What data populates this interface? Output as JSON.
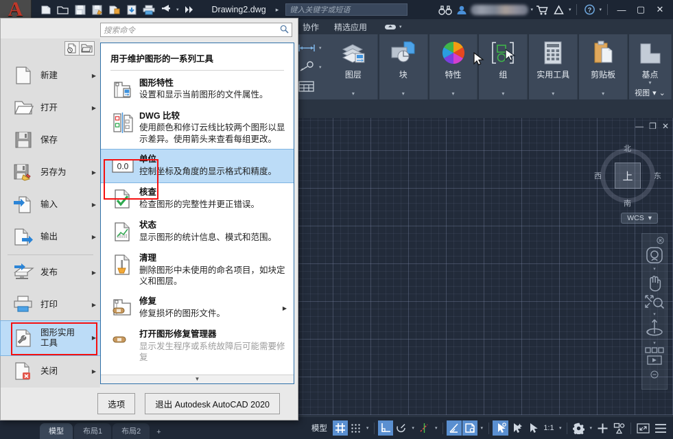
{
  "titlebar": {
    "doc_title": "Drawing2.dwg",
    "doc_arrow": "▸",
    "search_placeholder": "键入关键字或短语",
    "qat": [
      {
        "name": "new-icon"
      },
      {
        "name": "open-icon"
      },
      {
        "name": "save-icon"
      },
      {
        "name": "save-as-icon"
      },
      {
        "name": "plot-preview-icon"
      },
      {
        "name": "export-icon"
      },
      {
        "name": "print-icon"
      },
      {
        "name": "undo-icon"
      },
      {
        "name": "more-icon"
      }
    ],
    "minimize": "—",
    "maximize": "▢",
    "close": "✕",
    "help": "?",
    "user_name_blurred": ""
  },
  "ribbon": {
    "tabs": [
      {
        "label": "协作"
      },
      {
        "label": "精选应用"
      }
    ],
    "panels": [
      {
        "label": "图层",
        "icon": "layers-icon"
      },
      {
        "label": "块",
        "icon": "block-icon"
      },
      {
        "label": "特性",
        "icon": "properties-color-wheel-icon"
      },
      {
        "label": "组",
        "icon": "group-icon"
      },
      {
        "label": "实用工具",
        "icon": "calculator-icon"
      },
      {
        "label": "剪贴板",
        "icon": "clipboard-icon"
      },
      {
        "label": "基点",
        "icon": "basepoint-icon"
      }
    ],
    "view_label": "视图",
    "dropdown_glyph": "▾"
  },
  "canvas": {
    "doc_minimize": "—",
    "doc_restore": "❐",
    "doc_close": "✕",
    "viewcube": {
      "top": "上",
      "north": "北",
      "south": "南",
      "west": "西",
      "east": "东"
    },
    "wcs_label": "WCS",
    "wcs_caret": "▾",
    "navbar": [
      {
        "name": "steering-wheel-icon"
      },
      {
        "name": "pan-hand-icon"
      },
      {
        "name": "zoom-extents-icon"
      },
      {
        "name": "orbit-icon"
      },
      {
        "name": "showmotion-icon"
      }
    ]
  },
  "statusbar": {
    "tabs": [
      {
        "label": "模型",
        "active": true
      },
      {
        "label": "布局1",
        "active": false
      },
      {
        "label": "布局2",
        "active": false
      },
      {
        "label": "+",
        "active": false
      }
    ],
    "model_label": "模型",
    "scale": "1:1",
    "caret": "▾",
    "buttons": [
      {
        "name": "grid-display-toggle",
        "on": true
      },
      {
        "name": "snap-mode-toggle",
        "on": false
      },
      {
        "name": "ortho-mode-toggle",
        "on": true
      },
      {
        "name": "polar-tracking-toggle",
        "on": false
      },
      {
        "name": "object-snap-tracking-toggle",
        "on": false
      },
      {
        "name": "object-snap-toggle",
        "on": true
      },
      {
        "name": "annotation-visibility-toggle",
        "on": true
      },
      {
        "name": "autoscale-toggle",
        "on": true
      },
      {
        "name": "annotation-scale-toggle",
        "on": false
      },
      {
        "name": "workspace-switch-gear",
        "on": false
      },
      {
        "name": "isolate-objects-icon",
        "on": false
      },
      {
        "name": "hardware-acceleration-icon",
        "on": false
      },
      {
        "name": "fullscreen-icon",
        "on": false
      },
      {
        "name": "customization-menu-icon",
        "on": false
      }
    ]
  },
  "appmenu": {
    "search_placeholder": "搜索命令",
    "search_icon": "search-icon",
    "recent_docs_icon": "recent-documents-icon",
    "open_docs_icon": "open-documents-icon",
    "items": [
      {
        "label": "新建",
        "icon": "new-file-icon",
        "arrow": "▶",
        "selected": false
      },
      {
        "label": "打开",
        "icon": "open-folder-icon",
        "arrow": "▶",
        "selected": false
      },
      {
        "label": "保存",
        "icon": "save-floppy-icon",
        "arrow": "",
        "selected": false
      },
      {
        "label": "另存为",
        "icon": "save-as-icon",
        "arrow": "▶",
        "selected": false
      },
      {
        "label": "输入",
        "icon": "import-icon",
        "arrow": "▶",
        "selected": false
      },
      {
        "label": "输出",
        "icon": "export-icon",
        "arrow": "▶",
        "selected": false
      },
      {
        "label": "发布",
        "icon": "publish-icon",
        "arrow": "▶",
        "selected": false
      },
      {
        "label": "打印",
        "icon": "print-icon",
        "arrow": "▶",
        "selected": false
      },
      {
        "label": "图形实用\n工具",
        "icon": "drawing-utilities-wrench-icon",
        "arrow": "▶",
        "selected": true
      },
      {
        "label": "关闭",
        "icon": "close-file-icon",
        "arrow": "▶",
        "selected": false
      }
    ],
    "submenu": {
      "title": "用于维护图形的一系列工具",
      "rows": [
        {
          "title": "图形特性",
          "desc": "设置和显示当前图形的文件属性。",
          "icon": "drawing-properties-icon",
          "arrow": "",
          "selected": false
        },
        {
          "title": "DWG 比较",
          "desc": "使用颜色和修订云线比较两个图形以显示差异。使用箭头来查看每组更改。",
          "icon": "dwg-compare-icon",
          "arrow": "",
          "selected": false
        },
        {
          "title": "单位",
          "desc": "控制坐标及角度的显示格式和精度。",
          "icon": "units-icon",
          "icon_text": "0.0",
          "arrow": "",
          "selected": true
        },
        {
          "title": "核查",
          "desc": "检查图形的完整性并更正错误。",
          "icon": "audit-check-icon",
          "arrow": "",
          "selected": false
        },
        {
          "title": "状态",
          "desc": "显示图形的统计信息、模式和范围。",
          "icon": "status-chart-icon",
          "arrow": "",
          "selected": false
        },
        {
          "title": "清理",
          "desc": "删除图形中未使用的命名项目，如块定义和图层。",
          "icon": "purge-broom-icon",
          "arrow": "",
          "selected": false
        },
        {
          "title": "修复",
          "desc": "修复损坏的图形文件。",
          "icon": "recover-bandage-icon",
          "arrow": "▶",
          "selected": false
        },
        {
          "title": "打开图形修复管理器",
          "desc": "显示发生程序或系统故障后可能需要修复",
          "icon": "drawing-recovery-manager-icon",
          "arrow": "",
          "selected": false
        }
      ],
      "scroll_glyph": "▼"
    },
    "footer": {
      "options": "选项",
      "exit": "退出 Autodesk AutoCAD 2020"
    }
  },
  "colors": {
    "titlebar_bg": "#1c2533",
    "ribbon_bg": "#2a3442",
    "panel_bg": "#3c4859",
    "canvas_bg": "#222b3a",
    "accent_blue": "#5a8fd0",
    "menu_bg": "#e9e9e9",
    "menu_sel": "#bcdcf7",
    "annotation_red": "#f60f0f"
  }
}
